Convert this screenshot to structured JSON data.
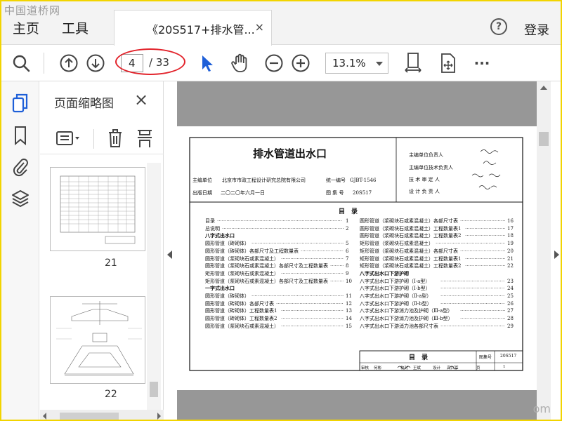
{
  "watermark": "中国道桥网",
  "watermark_right": "om",
  "menu": {
    "home": "主页",
    "tools": "工具",
    "help_icon": "?",
    "login": "登录"
  },
  "tab": {
    "title": "《20S517+排水管...",
    "close": "×"
  },
  "toolbar": {
    "page_current": "4",
    "page_total": "/ 33",
    "zoom": "13.1%",
    "more": "···"
  },
  "thumb_panel": {
    "title": "页面缩略图",
    "close": "×",
    "thumbs": [
      {
        "label": "21"
      },
      {
        "label": "22"
      }
    ]
  },
  "document": {
    "title": "排水管道出水口",
    "org_label": "主编单位",
    "org": "北京市市政工程设计研究总院有限公司",
    "code_label": "统一编号",
    "code": "GJBT-1546",
    "date_label": "出版日期",
    "date": "二〇二〇年六月一日",
    "atlas_label": "图 集 号",
    "atlas": "20S517",
    "roles": [
      "主编单位负责人",
      "主编单位技术负责人",
      "技 术 审 定 人",
      "设 计 负 责 人"
    ],
    "toc_title": "目　录",
    "toc_left": [
      {
        "t": "目录",
        "p": "1",
        "h": false
      },
      {
        "t": "总说明",
        "p": "2",
        "h": false
      },
      {
        "t": "八字式出水口",
        "p": "",
        "h": true
      },
      {
        "t": "圆形管道（砖砌体）",
        "p": "5",
        "h": false
      },
      {
        "t": "圆形管道（砖砌体）各部尺寸及工程数量表",
        "p": "6",
        "h": false
      },
      {
        "t": "圆形管道（浆砌块石或素混凝土）",
        "p": "7",
        "h": false
      },
      {
        "t": "圆形管道（浆砌块石或素混凝土）各部尺寸及工程数量表",
        "p": "8",
        "h": false
      },
      {
        "t": "矩形管道（浆砌块石或素混凝土）",
        "p": "9",
        "h": false
      },
      {
        "t": "矩形管道（浆砌块石或素混凝土）各部尺寸及工程数量表",
        "p": "10",
        "h": false
      },
      {
        "t": "一字式出水口",
        "p": "",
        "h": true
      },
      {
        "t": "圆形管道（砖砌体）",
        "p": "11",
        "h": false
      },
      {
        "t": "圆形管道（砖砌体）各部尺寸表",
        "p": "12",
        "h": false
      },
      {
        "t": "圆形管道（砖砌体）工程数量表1",
        "p": "13",
        "h": false
      },
      {
        "t": "圆形管道（砖砌体）工程数量表2",
        "p": "14",
        "h": false
      },
      {
        "t": "圆形管道（浆砌块石或素混凝土）",
        "p": "15",
        "h": false
      }
    ],
    "toc_right": [
      {
        "t": "圆形管道（浆砌块石或素混凝土）各部尺寸表",
        "p": "16",
        "h": false
      },
      {
        "t": "圆形管道（浆砌块石或素混凝土）工程数量表1",
        "p": "17",
        "h": false
      },
      {
        "t": "圆形管道（浆砌块石或素混凝土）工程数量表2",
        "p": "18",
        "h": false
      },
      {
        "t": "矩形管道（浆砌块石或素混凝土）",
        "p": "19",
        "h": false
      },
      {
        "t": "矩形管道（浆砌块石或素混凝土）各部尺寸表",
        "p": "20",
        "h": false
      },
      {
        "t": "矩形管道（浆砌块石或素混凝土）工程数量表1",
        "p": "21",
        "h": false
      },
      {
        "t": "矩形管道（浆砌块石或素混凝土）工程数量表2",
        "p": "22",
        "h": false
      },
      {
        "t": "八字式出水口下游护砌",
        "p": "",
        "h": true
      },
      {
        "t": "八字式出水口下游护砌（Ⅰ-a型）",
        "p": "23",
        "h": false
      },
      {
        "t": "八字式出水口下游护砌（Ⅰ-b型）",
        "p": "24",
        "h": false
      },
      {
        "t": "八字式出水口下游护砌（Ⅱ-a型）",
        "p": "25",
        "h": false
      },
      {
        "t": "八字式出水口下游护砌（Ⅱ-b型）",
        "p": "26",
        "h": false
      },
      {
        "t": "八字式出水口下游消力池及护砌（Ⅲ-a型）",
        "p": "27",
        "h": false
      },
      {
        "t": "八字式出水口下游消力池及护砌（Ⅲ-b型）",
        "p": "28",
        "h": false
      },
      {
        "t": "八字式出水口下游消力池各部尺寸表",
        "p": "29",
        "h": false
      }
    ],
    "tb_title": "目　录",
    "tb_atlas_label": "图集号",
    "tb_atlas": "20S517",
    "tb_row": [
      "审核",
      "何彬",
      "校对",
      "王斌",
      "设计",
      "高兴军",
      "页",
      "1"
    ]
  }
}
